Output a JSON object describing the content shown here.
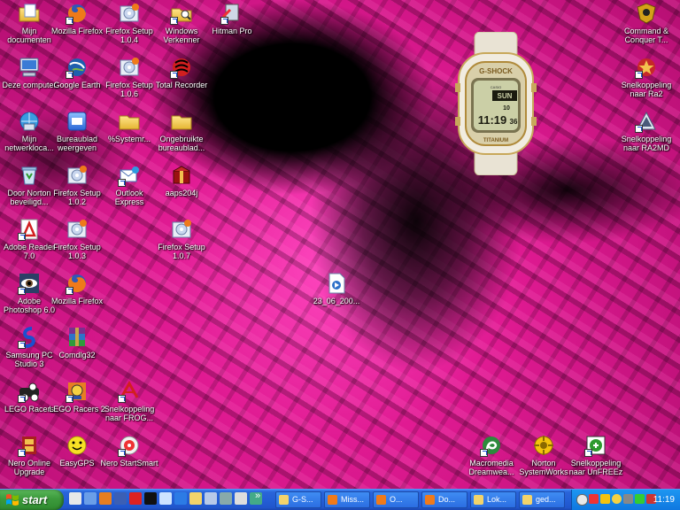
{
  "desktop_icons": [
    {
      "id": "mijn-documenten",
      "label": "Mijn documenten",
      "icon": "folder-documents-icon",
      "shortcut": false
    },
    {
      "id": "deze-computer",
      "label": "Deze computer",
      "icon": "computer-icon",
      "shortcut": false
    },
    {
      "id": "mijn-netwerklocaties",
      "label": "Mijn netwerkloca...",
      "icon": "network-places-icon",
      "shortcut": false
    },
    {
      "id": "door-norton",
      "label": "Door Norton beveiligd...",
      "icon": "recycle-bin-icon",
      "shortcut": false
    },
    {
      "id": "adobe-reader",
      "label": "Adobe Reader 7.0",
      "icon": "adobe-reader-icon",
      "shortcut": true
    },
    {
      "id": "adobe-photoshop",
      "label": "Adobe Photoshop 6.0",
      "icon": "photoshop-eye-icon",
      "shortcut": true
    },
    {
      "id": "samsung-pc-studio",
      "label": "Samsung PC Studio 3",
      "icon": "samsung-icon",
      "shortcut": true
    },
    {
      "id": "lego-racers",
      "label": "LEGO Racers",
      "icon": "lego-racers-icon",
      "shortcut": true
    },
    {
      "id": "nero-online-upgrade",
      "label": "Nero Online Upgrade",
      "icon": "nero-upgrade-icon",
      "shortcut": true
    },
    {
      "id": "mozilla-firefox-1",
      "label": "Mozilla Firefox",
      "icon": "firefox-icon",
      "shortcut": true
    },
    {
      "id": "google-earth",
      "label": "Google Earth",
      "icon": "google-earth-icon",
      "shortcut": true
    },
    {
      "id": "bureaublad-weergeven",
      "label": "Bureaublad weergeven",
      "icon": "show-desktop-icon",
      "shortcut": false
    },
    {
      "id": "firefox-setup-102",
      "label": "Firefox Setup 1.0.2",
      "icon": "installer-icon",
      "shortcut": false
    },
    {
      "id": "firefox-setup-103",
      "label": "Firefox Setup 1.0.3",
      "icon": "installer-icon",
      "shortcut": false
    },
    {
      "id": "mozilla-firefox-2",
      "label": "Mozilla Firefox",
      "icon": "firefox-icon",
      "shortcut": true
    },
    {
      "id": "comdlg32",
      "label": "Comdlg32",
      "icon": "winrar-icon",
      "shortcut": false
    },
    {
      "id": "lego-racers-2",
      "label": "LEGO Racers 2",
      "icon": "lego-racers-2-icon",
      "shortcut": true
    },
    {
      "id": "easygps",
      "label": "EasyGPS",
      "icon": "smiley-icon",
      "shortcut": false
    },
    {
      "id": "firefox-setup-104",
      "label": "Firefox Setup 1.0.4",
      "icon": "installer-icon",
      "shortcut": false
    },
    {
      "id": "firefox-setup-106",
      "label": "Firefox Setup 1.0.6",
      "icon": "installer-icon",
      "shortcut": false
    },
    {
      "id": "systemroot",
      "label": "%Systemr...",
      "icon": "folder-icon",
      "shortcut": false
    },
    {
      "id": "outlook-express",
      "label": "Outlook Express",
      "icon": "outlook-express-icon",
      "shortcut": true
    },
    {
      "id": "snelkoppeling-frog",
      "label": "Snelkoppeling naar FROG...",
      "icon": "frog-icon",
      "shortcut": true
    },
    {
      "id": "nero-startsmart",
      "label": "Nero StartSmart",
      "icon": "nero-icon",
      "shortcut": true
    },
    {
      "id": "windows-verkenner",
      "label": "Windows Verkenner",
      "icon": "explorer-icon",
      "shortcut": true
    },
    {
      "id": "total-recorder",
      "label": "Total Recorder",
      "icon": "total-recorder-icon",
      "shortcut": true
    },
    {
      "id": "ongebruikte-bureaublad",
      "label": "Ongebruikte bureaublad...",
      "icon": "folder-icon",
      "shortcut": false
    },
    {
      "id": "aaps204j",
      "label": "aaps204j",
      "icon": "package-icon",
      "shortcut": false
    },
    {
      "id": "firefox-setup-107",
      "label": "Firefox Setup 1.0.7",
      "icon": "installer-icon",
      "shortcut": false
    },
    {
      "id": "hitman-pro",
      "label": "Hitman Pro",
      "icon": "hitman-icon",
      "shortcut": true
    },
    {
      "id": "file-23-06",
      "label": "23_06_200...",
      "icon": "media-file-icon",
      "shortcut": false
    },
    {
      "id": "command-conquer",
      "label": "Command & Conquer T...",
      "icon": "command-conquer-icon",
      "shortcut": false
    },
    {
      "id": "snelkoppeling-ra2",
      "label": "Snelkoppeling naar Ra2",
      "icon": "ra2-icon",
      "shortcut": true
    },
    {
      "id": "snelkoppeling-ra2md",
      "label": "Snelkoppeling naar RA2MD",
      "icon": "ra2md-icon",
      "shortcut": true
    },
    {
      "id": "macromedia-dreamweaver",
      "label": "Macromedia Dreamwea...",
      "icon": "dreamweaver-icon",
      "shortcut": true
    },
    {
      "id": "norton-systemworks",
      "label": "Norton SystemWorks",
      "icon": "norton-icon",
      "shortcut": false
    },
    {
      "id": "snelkoppeling-unfreez",
      "label": "Snelkoppeling naar UnFREEz",
      "icon": "unfreez-icon",
      "shortcut": true
    }
  ],
  "watch": {
    "brand": "G-SHOCK",
    "maker": "CASIO",
    "bezel": "TITANIUM",
    "day": "SUN",
    "date": "10",
    "time": "11:19",
    "seconds": "36"
  },
  "taskbar": {
    "start_label": "start",
    "quicklaunch_overflow": "»",
    "tasks": [
      {
        "label": "G-S...",
        "icon": "folder-icon"
      },
      {
        "label": "Miss...",
        "icon": "firefox-icon"
      },
      {
        "label": "O...",
        "icon": "firefox-icon"
      },
      {
        "label": "Do...",
        "icon": "firefox-icon"
      },
      {
        "label": "Lok...",
        "icon": "folder-icon"
      },
      {
        "label": "ged...",
        "icon": "folder-icon"
      }
    ],
    "clock": "11:19"
  },
  "colors": {
    "wallpaper_pink": "#e01a92",
    "taskbar_blue": "#245ed6",
    "start_green": "#3c9a3c",
    "tray_blue": "#0f78e0"
  }
}
